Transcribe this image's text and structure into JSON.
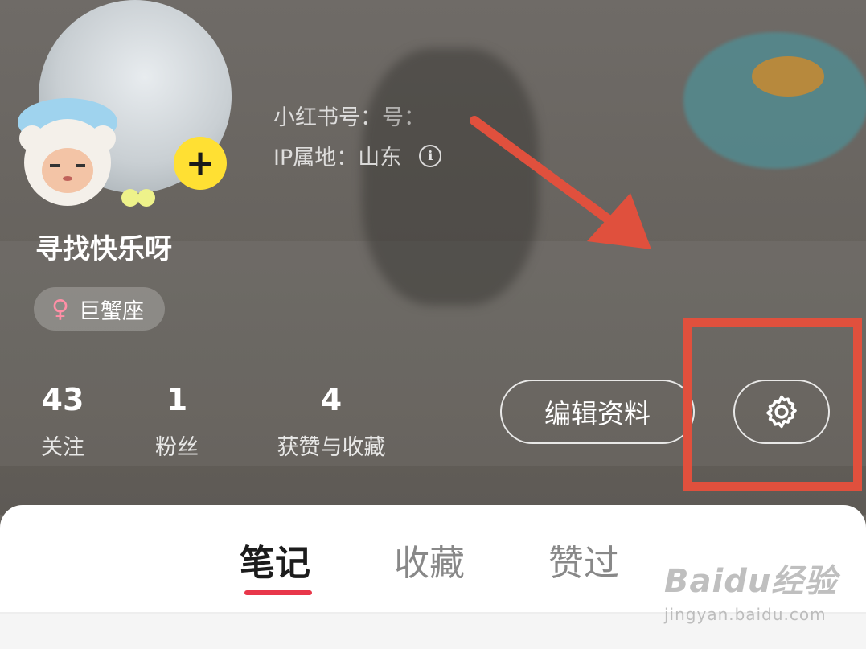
{
  "profile": {
    "nickname": "寻找快乐呀",
    "account_id_label": "小红书号：",
    "account_id_value": "号：",
    "ip_label": "IP属地：",
    "ip_value": "山东",
    "zodiac": "巨蟹座",
    "zodiac_symbol": "♀"
  },
  "stats": [
    {
      "value": "43",
      "label": "关注"
    },
    {
      "value": "1",
      "label": "粉丝"
    },
    {
      "value": "4",
      "label": "获赞与收藏"
    }
  ],
  "actions": {
    "edit_label": "编辑资料",
    "add_symbol": "+"
  },
  "tabs": [
    {
      "label": "笔记",
      "active": true
    },
    {
      "label": "收藏",
      "active": false
    },
    {
      "label": "赞过",
      "active": false
    }
  ],
  "colors": {
    "accent": "#e8374a",
    "annotation": "#e0503d",
    "add_button": "#ffe033"
  },
  "icons": {
    "settings": "gear-icon",
    "info": "info-icon",
    "female": "female-icon"
  },
  "watermark": {
    "logo": "Baidu经验",
    "url": "jingyan.baidu.com"
  }
}
